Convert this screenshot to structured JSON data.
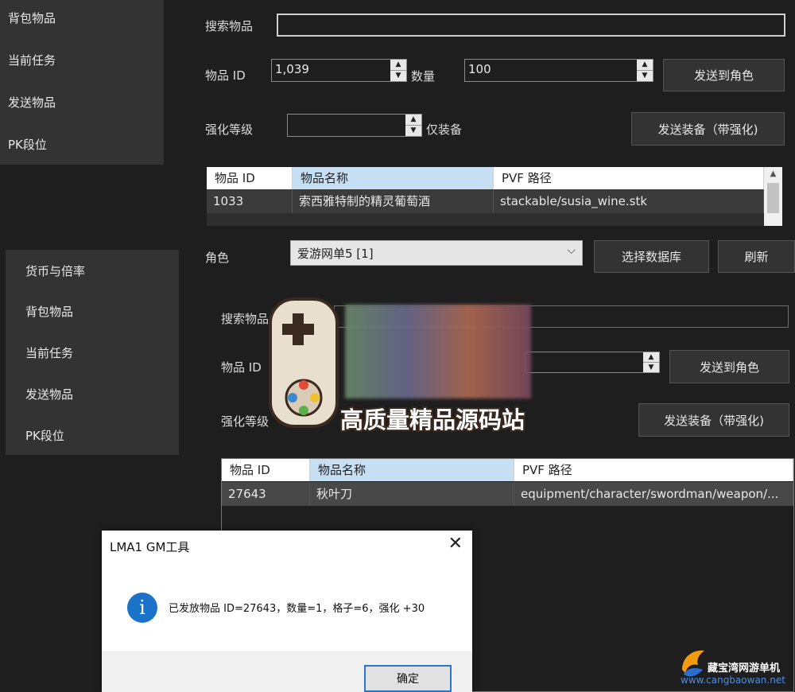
{
  "top": {
    "sidebar": [
      "背包物品",
      "当前任务",
      "发送物品",
      "PK段位"
    ],
    "search_label": "搜索物品",
    "item_id_label": "物品 ID",
    "item_id_value": "1,039",
    "qty_label": "数量",
    "qty_value": "100",
    "send_to_char": "发送到角色",
    "enhance_label": "强化等级",
    "equip_only": "仅装备",
    "send_equip": "发送装备（带强化)",
    "table": {
      "headers": [
        "物品 ID",
        "物品名称",
        "PVF 路径"
      ],
      "rows": [
        [
          "1033",
          "索西雅特制的精灵葡萄酒",
          "stackable/susia_wine.stk"
        ]
      ]
    }
  },
  "role": {
    "label": "角色",
    "selected": "爱游网单5 [1]",
    "select_db": "选择数据库",
    "refresh": "刷新"
  },
  "bottom": {
    "sidebar": [
      "货币与倍率",
      "背包物品",
      "当前任务",
      "发送物品",
      "PK段位"
    ],
    "search_label": "搜索物品",
    "item_id_label": "物品 ID",
    "send_to_char": "发送到角色",
    "enhance_label": "强化等级",
    "send_equip": "发送装备（带强化)",
    "table": {
      "headers": [
        "物品 ID",
        "物品名称",
        "PVF 路径"
      ],
      "rows": [
        [
          "27643",
          "秋叶刀",
          "equipment/character/swordman/weapon/..."
        ]
      ]
    }
  },
  "overlay": {
    "text": "高质量精品源码站"
  },
  "dialog": {
    "title": "LMA1 GM工具",
    "message": "已发放物品 ID=27643，数量=1，格子=6，强化 +30",
    "ok": "确定"
  },
  "watermark": {
    "name": "藏宝湾网游单机",
    "url": "www.cangbaowan.net"
  },
  "colors": {
    "bg": "#1e1e1e",
    "panel": "#333333",
    "header_selected": "#c7dff3",
    "info_blue": "#1a73c9"
  }
}
